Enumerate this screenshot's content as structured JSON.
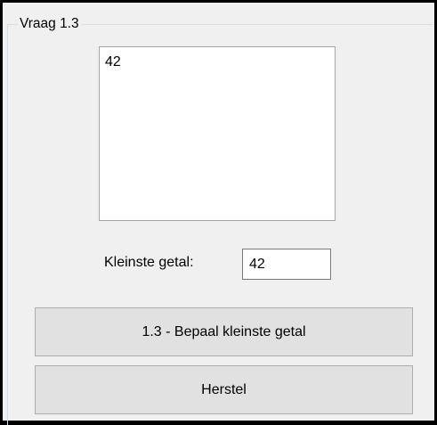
{
  "group": {
    "title": "Vraag 1.3"
  },
  "listbox": {
    "items": [
      "42"
    ]
  },
  "smallest": {
    "label": "Kleinste getal:",
    "value": "42"
  },
  "buttons": {
    "determine_label": "1.3 - Bepaal kleinste getal",
    "reset_label": "Herstel"
  },
  "colors": {
    "background": "#f0f0f0",
    "button_face": "#e1e1e1",
    "button_border": "#adadad",
    "frame": "#000000"
  }
}
